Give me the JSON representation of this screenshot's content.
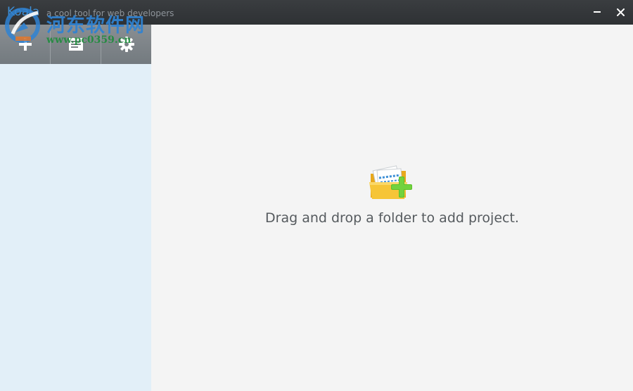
{
  "window": {
    "app_name": "Koala",
    "tagline": "a cool tool for web developers",
    "minimize_icon": "minimize-icon",
    "close_icon": "close-icon"
  },
  "watermark": {
    "title": "河东软件网",
    "url": "www.pc0359.cn"
  },
  "sidebar": {
    "toolbar": [
      {
        "icon": "add-project-icon"
      },
      {
        "icon": "document-log-icon"
      },
      {
        "icon": "gear-icon"
      }
    ],
    "colors": {
      "toolbar": "#7d8388",
      "panel": "#e2eff8"
    }
  },
  "main": {
    "drop_icon": "folder-add-icon",
    "drop_hint": "Drag and drop a folder to add project."
  }
}
